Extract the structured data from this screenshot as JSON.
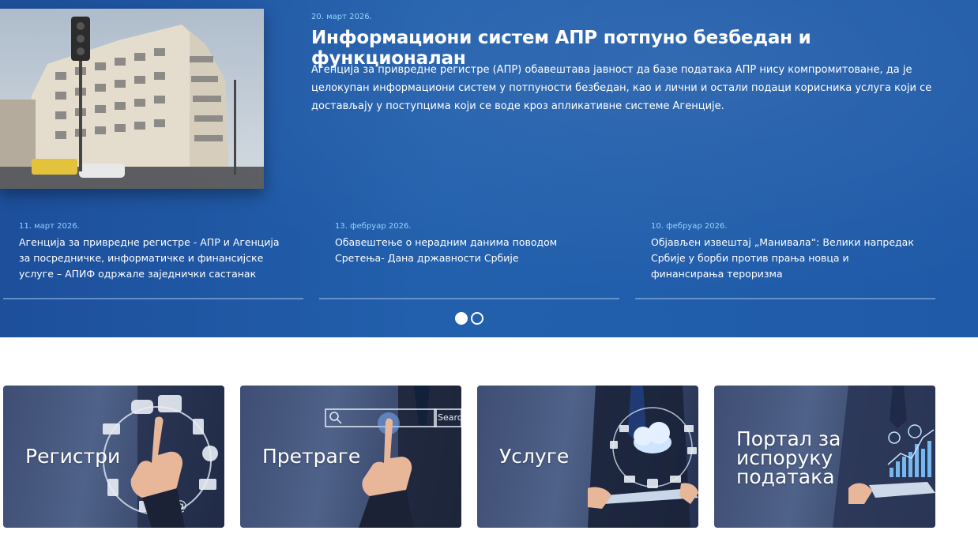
{
  "featured": {
    "date": "20. март 2026.",
    "title": "Информациони систем АПР потпуно безбедан и функционалан",
    "text": "Агенција за привредне регистре (АПР) обавештава јавност да базе података АПР нису компромитоване, да је целокупан информациони систем у потпуности безбедан, као и лични и остали подаци корисника услуга који се достављају у поступцима који се воде кроз апликативне системе Агенције."
  },
  "news": [
    {
      "date": "11. март 2026.",
      "title": "Агенција за привредне регистре - АПР и Агенција за посредничке, информатичке и финансијске услуге – АПИФ одржале заједнички састанак"
    },
    {
      "date": "13. фебруар 2026.",
      "title": "Обавештење о нерадним данима поводом Сретења- Дана државности Србије"
    },
    {
      "date": "10. фебруар 2026.",
      "title": "Објављен извештај „Манивала“: Велики напредак Србије у борби против прања новца и финансирања тероризма"
    }
  ],
  "slider": {
    "active_index": 0,
    "count": 2
  },
  "tiles": [
    {
      "label": "Регистри",
      "icon": "network-hand-icon"
    },
    {
      "label": "Претраге",
      "icon": "search-hand-icon"
    },
    {
      "label": "Услуге",
      "icon": "cloud-services-icon"
    },
    {
      "label": "Портал за испоруку података",
      "icon": "data-chart-icon"
    }
  ],
  "search_box_text": "Search",
  "colors": {
    "hero": "#2260ad",
    "date": "#8fd3ff",
    "tile": "#3e4d73"
  }
}
